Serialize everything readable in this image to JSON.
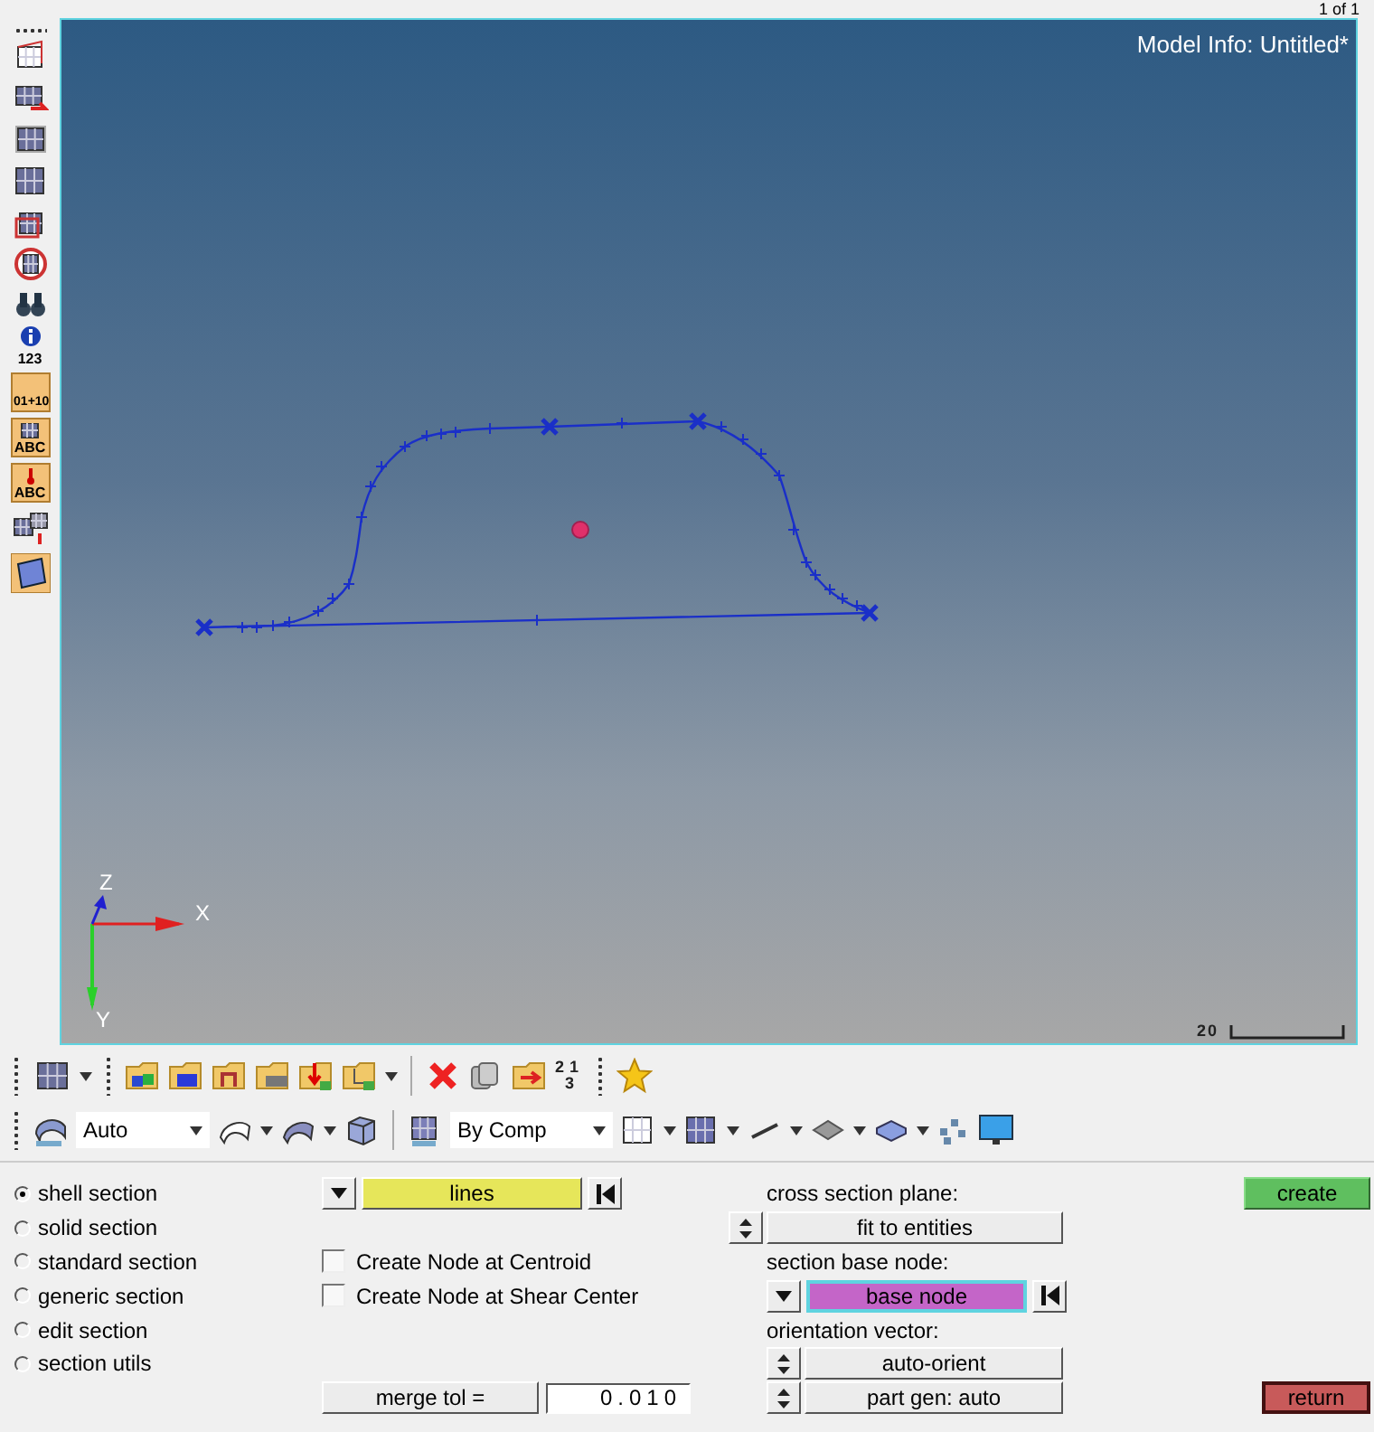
{
  "page_counter": "1 of 1",
  "left_toolbar": {
    "ruler_captions": [
      "0",
      "1",
      "+10"
    ],
    "info_caption": "123",
    "label_captions": [
      "ABC",
      "ABC"
    ]
  },
  "viewport": {
    "model_info": "Model Info: Untitled*",
    "axis_labels": {
      "z": "Z",
      "x": "X",
      "y": "Y"
    },
    "scale": "20"
  },
  "toolbar": {
    "renumber_digits": [
      "2",
      "1",
      "3"
    ],
    "auto_select": "Auto",
    "color_select": "By Comp"
  },
  "panel": {
    "section_types": [
      {
        "label": "shell section",
        "selected": true
      },
      {
        "label": "solid section",
        "selected": false
      },
      {
        "label": "standard section",
        "selected": false
      },
      {
        "label": "generic section",
        "selected": false
      },
      {
        "label": "edit section",
        "selected": false
      },
      {
        "label": "section utils",
        "selected": false
      }
    ],
    "entity_selector": {
      "value": "lines"
    },
    "checkboxes": [
      {
        "label": "Create Node at Centroid",
        "checked": false
      },
      {
        "label": "Create Node at Shear Center",
        "checked": false
      }
    ],
    "merge_tol": {
      "label": "merge tol =",
      "value": "0.010"
    },
    "cross_section_plane": {
      "label": "cross section plane:",
      "value": "fit to entities"
    },
    "base_node": {
      "label": "section base node:",
      "value": "base node"
    },
    "orientation_vector": {
      "label": "orientation vector:",
      "value": "auto-orient"
    },
    "part_gen": {
      "value": "part gen: auto"
    },
    "create_button": "create",
    "return_button": "return"
  }
}
